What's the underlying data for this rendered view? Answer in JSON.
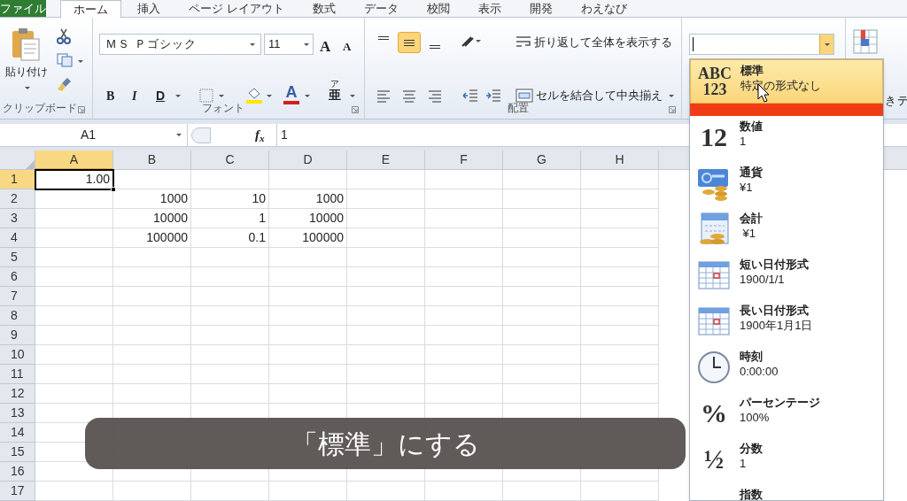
{
  "tabs": [
    {
      "label": "ファイル",
      "kind": "file",
      "selected": false
    },
    {
      "label": "ホーム",
      "kind": "tab",
      "selected": true
    },
    {
      "label": "挿入",
      "kind": "tab",
      "selected": false
    },
    {
      "label": "ページ レイアウト",
      "kind": "tab",
      "selected": false
    },
    {
      "label": "数式",
      "kind": "tab",
      "selected": false
    },
    {
      "label": "データ",
      "kind": "tab",
      "selected": false
    },
    {
      "label": "校閲",
      "kind": "tab",
      "selected": false
    },
    {
      "label": "表示",
      "kind": "tab",
      "selected": false
    },
    {
      "label": "開発",
      "kind": "tab",
      "selected": false
    },
    {
      "label": "わえなび",
      "kind": "tab",
      "selected": false
    }
  ],
  "clipboard": {
    "paste": "貼り付け",
    "group": "クリップボード"
  },
  "font": {
    "name": "ＭＳ Ｐゴシック",
    "size": "11",
    "grow": "A",
    "shrink": "A",
    "bold": "B",
    "italic": "I",
    "underline": "D",
    "font_color": "A",
    "phonetic": "亜",
    "phonetic_ruby": "ア",
    "group": "フォント"
  },
  "alignment": {
    "vertical": [
      {
        "selected": false
      },
      {
        "selected": true
      },
      {
        "selected": false
      }
    ],
    "wrap": "折り返して全体を表示する",
    "merge": "セルを結合して中央揃え",
    "group": "配置"
  },
  "ribbon_fragments": [
    "き",
    "テ"
  ],
  "formula_bar": {
    "name_box": "A1",
    "fx": "f$_{x}$",
    "formula": "1"
  },
  "grid": {
    "columns": [
      {
        "label": "A",
        "selected": true
      },
      {
        "label": "B",
        "selected": false
      },
      {
        "label": "C",
        "selected": false
      },
      {
        "label": "D",
        "selected": false
      },
      {
        "label": "E",
        "selected": false
      },
      {
        "label": "F",
        "selected": false
      },
      {
        "label": "G",
        "selected": false
      },
      {
        "label": "H",
        "selected": false
      }
    ],
    "rows": [
      {
        "label": "1",
        "selected": true,
        "cells": [
          "1.00"
        ]
      },
      {
        "label": "2",
        "selected": false,
        "cells": [
          "",
          "1000",
          "10",
          "1000"
        ]
      },
      {
        "label": "3",
        "selected": false,
        "cells": [
          "",
          "10000",
          "1",
          "10000"
        ]
      },
      {
        "label": "4",
        "selected": false,
        "cells": [
          "",
          "100000",
          "0.1",
          "100000"
        ]
      },
      {
        "label": "5",
        "selected": false
      },
      {
        "label": "6",
        "selected": false
      },
      {
        "label": "7",
        "selected": false
      },
      {
        "label": "8",
        "selected": false
      },
      {
        "label": "9",
        "selected": false
      },
      {
        "label": "10",
        "selected": false
      },
      {
        "label": "11",
        "selected": false
      },
      {
        "label": "12",
        "selected": false
      },
      {
        "label": "13",
        "selected": false
      },
      {
        "label": "14",
        "selected": false
      },
      {
        "label": "15",
        "selected": false
      },
      {
        "label": "16",
        "selected": false
      },
      {
        "label": "17",
        "selected": false
      }
    ]
  },
  "number_format_menu": [
    {
      "kind": "text",
      "icon_text": [
        "ABC",
        "123"
      ],
      "label": "標準",
      "value": "特定の形式なし",
      "selected": true
    },
    {
      "kind": "text",
      "icon_text": [
        "12"
      ],
      "label": "数値",
      "value": "1",
      "selected": false
    },
    {
      "kind": "currency",
      "label": "通貨",
      "value": "¥1",
      "selected": false
    },
    {
      "kind": "accounting",
      "label": "会計",
      "value": " ¥1",
      "selected": false
    },
    {
      "kind": "date",
      "label": "短い日付形式",
      "value": "1900/1/1",
      "selected": false
    },
    {
      "kind": "date",
      "label": "長い日付形式",
      "value": "1900年1月1日",
      "selected": false
    },
    {
      "kind": "time",
      "label": "時刻",
      "value": "0:00:00",
      "selected": false
    },
    {
      "kind": "text",
      "icon_text": [
        "%"
      ],
      "label": "パーセンテージ",
      "value": "100%",
      "selected": false
    },
    {
      "kind": "text",
      "icon_text": [
        "½"
      ],
      "label": "分数",
      "value": "1",
      "selected": false
    },
    {
      "kind": "none",
      "label": "指数",
      "selected": false
    }
  ],
  "caption": "「標準」にする"
}
